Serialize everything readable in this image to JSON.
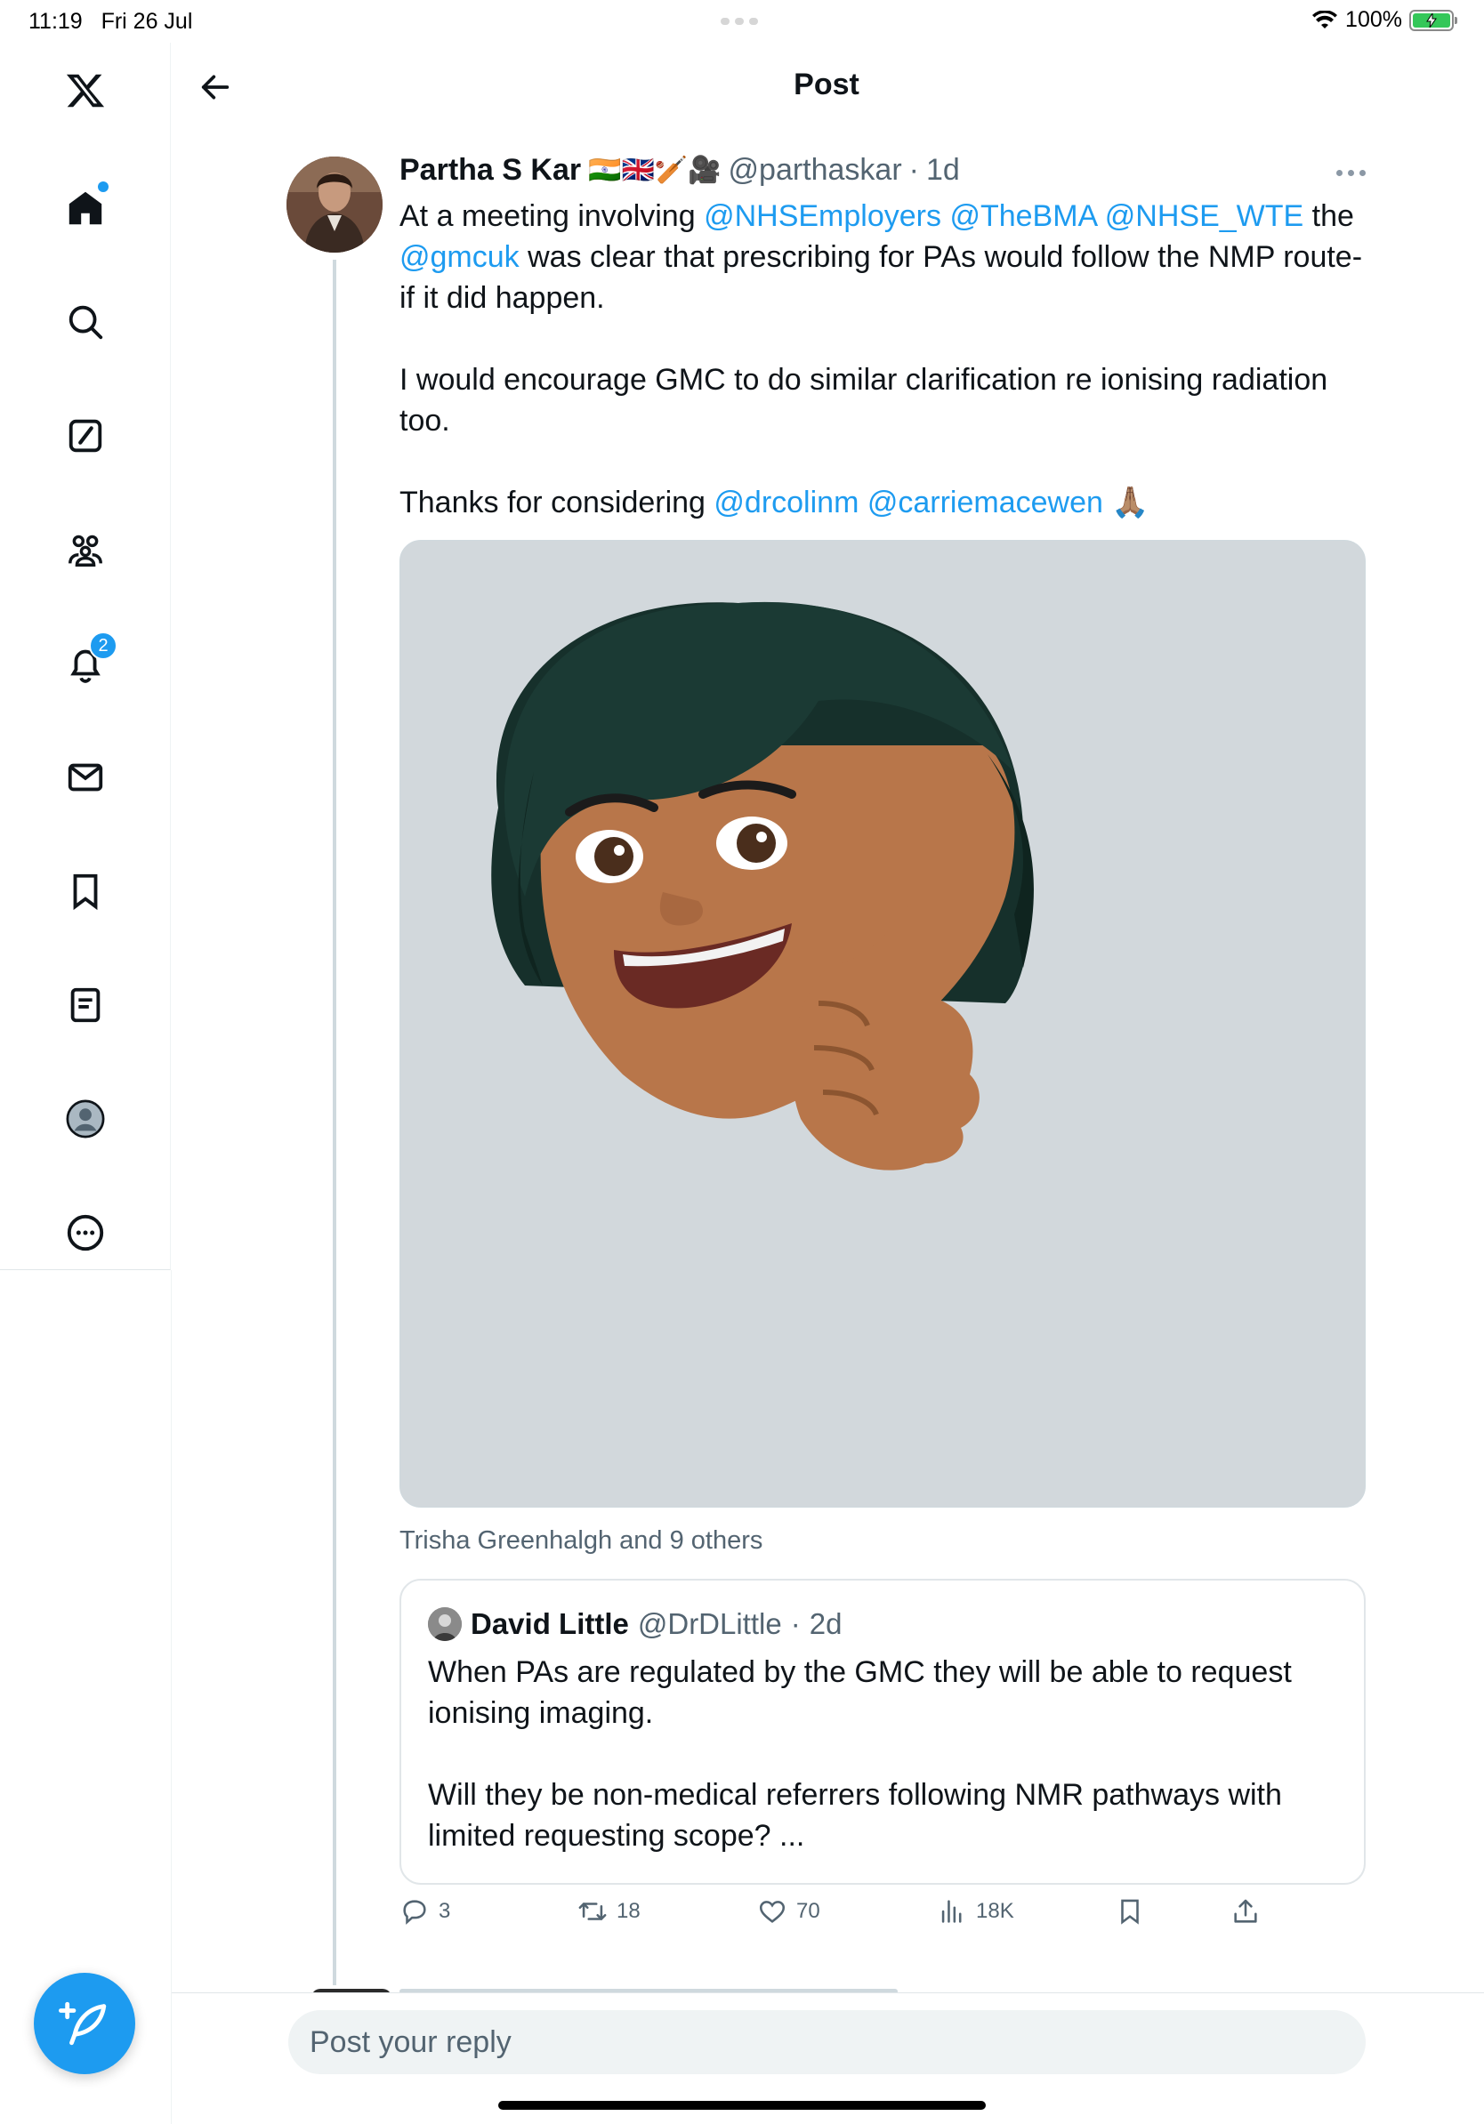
{
  "status_bar": {
    "time": "11:19",
    "date": "Fri 26 Jul",
    "battery": "100%"
  },
  "sidebar": {
    "items": [
      {
        "name": "x-logo"
      },
      {
        "name": "home-icon"
      },
      {
        "name": "search-icon"
      },
      {
        "name": "grok-icon"
      },
      {
        "name": "communities-icon"
      },
      {
        "name": "notifications-icon",
        "badge": "2"
      },
      {
        "name": "messages-icon"
      },
      {
        "name": "bookmarks-icon"
      },
      {
        "name": "lists-icon"
      },
      {
        "name": "profile-icon"
      },
      {
        "name": "more-icon"
      }
    ]
  },
  "header": {
    "title": "Post"
  },
  "tweet": {
    "author_name": "Partha S Kar",
    "author_emojis": "🇮🇳🇬🇧🏏🎥",
    "handle": "@parthaskar",
    "separator": "·",
    "time": "1d",
    "text": {
      "line1_pre": "At a meeting involving ",
      "m1": "@NHSEmployers",
      "m2": "@TheBMA",
      "m3": "@NHSE_WTE",
      "line1_post": " the",
      "m4": "@gmcuk",
      "line2": " was clear that prescribing for PAs would follow the NMP route- if it did happen.",
      "para2": "I would encourage GMC to do similar clarification re ionising radiation too.",
      "para3_pre": "Thanks for considering ",
      "m5": "@drcolinm",
      "m6": "@carriemacewen",
      "para3_emoji": "🙏🏽"
    },
    "tagged": "Trisha Greenhalgh and 9 others",
    "quote": {
      "name": "David Little",
      "handle": "@DrDLittle",
      "separator": "·",
      "time": "2d",
      "para1": "When PAs are regulated by the GMC they will be able to request ionising imaging.",
      "para2": "Will they be non-medical referrers following NMR pathways with limited requesting scope? ..."
    },
    "actions": {
      "replies": "3",
      "reposts": "18",
      "likes": "70",
      "views": "18K"
    }
  },
  "reply": {
    "placeholder": "Post your reply"
  },
  "colors": {
    "accent": "#1d9bf0",
    "text": "#0f1419",
    "muted": "#536471"
  }
}
